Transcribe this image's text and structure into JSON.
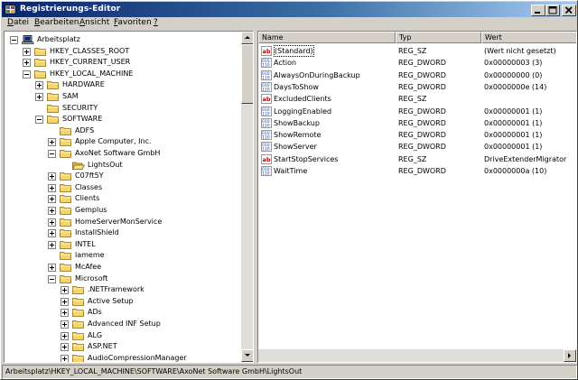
{
  "window": {
    "title": "Registrierungs-Editor"
  },
  "menu": [
    {
      "accel": "D",
      "rest": "atei"
    },
    {
      "accel": "B",
      "rest": "earbeiten"
    },
    {
      "accel": "A",
      "rest": "nsicht"
    },
    {
      "accel": "F",
      "rest": "avoriten"
    },
    {
      "accel": "?",
      "rest": ""
    }
  ],
  "tree": [
    {
      "label": "Arbeitsplatz",
      "level": 0,
      "expander": "minus",
      "icon": "computer-icon"
    },
    {
      "label": "HKEY_CLASSES_ROOT",
      "level": 1,
      "expander": "plus",
      "icon": "folder-icon"
    },
    {
      "label": "HKEY_CURRENT_USER",
      "level": 1,
      "expander": "plus",
      "icon": "folder-icon"
    },
    {
      "label": "HKEY_LOCAL_MACHINE",
      "level": 1,
      "expander": "minus",
      "icon": "folder-icon"
    },
    {
      "label": "HARDWARE",
      "level": 2,
      "expander": "plus",
      "icon": "folder-icon"
    },
    {
      "label": "SAM",
      "level": 2,
      "expander": "plus",
      "icon": "folder-icon"
    },
    {
      "label": "SECURITY",
      "level": 2,
      "expander": "none",
      "icon": "folder-icon"
    },
    {
      "label": "SOFTWARE",
      "level": 2,
      "expander": "minus",
      "icon": "folder-icon"
    },
    {
      "label": "ADFS",
      "level": 3,
      "expander": "none",
      "icon": "folder-icon"
    },
    {
      "label": "Apple Computer, Inc.",
      "level": 3,
      "expander": "plus",
      "icon": "folder-icon"
    },
    {
      "label": "AxoNet Software GmbH",
      "level": 3,
      "expander": "minus",
      "icon": "folder-icon"
    },
    {
      "label": "LightsOut",
      "level": 4,
      "expander": "none",
      "icon": "folder-open-icon"
    },
    {
      "label": "C07ft5Y",
      "level": 3,
      "expander": "plus",
      "icon": "folder-icon"
    },
    {
      "label": "Classes",
      "level": 3,
      "expander": "plus",
      "icon": "folder-icon"
    },
    {
      "label": "Clients",
      "level": 3,
      "expander": "plus",
      "icon": "folder-icon"
    },
    {
      "label": "Gemplus",
      "level": 3,
      "expander": "plus",
      "icon": "folder-icon"
    },
    {
      "label": "HomeServerMonService",
      "level": 3,
      "expander": "plus",
      "icon": "folder-icon"
    },
    {
      "label": "InstallShield",
      "level": 3,
      "expander": "plus",
      "icon": "folder-icon"
    },
    {
      "label": "INTEL",
      "level": 3,
      "expander": "plus",
      "icon": "folder-icon"
    },
    {
      "label": "lameme",
      "level": 3,
      "expander": "none",
      "icon": "folder-icon"
    },
    {
      "label": "McAfee",
      "level": 3,
      "expander": "plus",
      "icon": "folder-icon"
    },
    {
      "label": "Microsoft",
      "level": 3,
      "expander": "minus",
      "icon": "folder-icon"
    },
    {
      "label": ".NETFramework",
      "level": 4,
      "expander": "plus",
      "icon": "folder-icon"
    },
    {
      "label": "Active Setup",
      "level": 4,
      "expander": "plus",
      "icon": "folder-icon"
    },
    {
      "label": "ADs",
      "level": 4,
      "expander": "plus",
      "icon": "folder-icon"
    },
    {
      "label": "Advanced INF Setup",
      "level": 4,
      "expander": "plus",
      "icon": "folder-icon"
    },
    {
      "label": "ALG",
      "level": 4,
      "expander": "plus",
      "icon": "folder-icon"
    },
    {
      "label": "ASP.NET",
      "level": 4,
      "expander": "plus",
      "icon": "folder-icon"
    },
    {
      "label": "AudioCompressionManager",
      "level": 4,
      "expander": "plus",
      "icon": "folder-icon"
    }
  ],
  "columns": {
    "name": "Name",
    "type": "Typ",
    "data": "Wert"
  },
  "values": [
    {
      "name": "(Standard)",
      "type": "REG_SZ",
      "data": "(Wert nicht gesetzt)",
      "icon": "string-value-icon"
    },
    {
      "name": "Action",
      "type": "REG_DWORD",
      "data": "0x00000003 (3)",
      "icon": "dword-value-icon"
    },
    {
      "name": "AlwaysOnDuringBackup",
      "type": "REG_DWORD",
      "data": "0x00000000 (0)",
      "icon": "dword-value-icon"
    },
    {
      "name": "DaysToShow",
      "type": "REG_DWORD",
      "data": "0x0000000e (14)",
      "icon": "dword-value-icon"
    },
    {
      "name": "ExcludedClients",
      "type": "REG_SZ",
      "data": "",
      "icon": "string-value-icon"
    },
    {
      "name": "LoggingEnabled",
      "type": "REG_DWORD",
      "data": "0x00000001 (1)",
      "icon": "dword-value-icon"
    },
    {
      "name": "ShowBackup",
      "type": "REG_DWORD",
      "data": "0x00000001 (1)",
      "icon": "dword-value-icon"
    },
    {
      "name": "ShowRemote",
      "type": "REG_DWORD",
      "data": "0x00000001 (1)",
      "icon": "dword-value-icon"
    },
    {
      "name": "ShowServer",
      "type": "REG_DWORD",
      "data": "0x00000001 (1)",
      "icon": "dword-value-icon"
    },
    {
      "name": "StartStopServices",
      "type": "REG_SZ",
      "data": "DriveExtenderMigrator",
      "icon": "string-value-icon"
    },
    {
      "name": "WaitTime",
      "type": "REG_DWORD",
      "data": "0x0000000a (10)",
      "icon": "dword-value-icon"
    }
  ],
  "status": {
    "path": "Arbeitsplatz\\HKEY_LOCAL_MACHINE\\SOFTWARE\\AxoNet Software GmbH\\LightsOut"
  }
}
